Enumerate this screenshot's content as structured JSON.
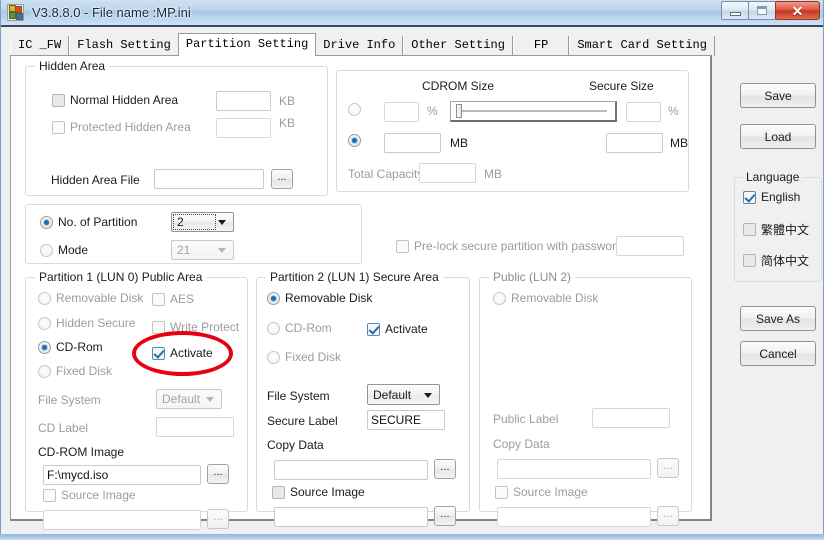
{
  "window": {
    "title": "V3.8.8.0 - File name :MP.ini",
    "icon": "blocks-icon",
    "buttons": {
      "minimize": "minimize-icon",
      "maximize": "maximize-icon",
      "close": "close-icon"
    }
  },
  "tabs": [
    {
      "label": "IC _FW",
      "selected": false
    },
    {
      "label": "Flash Setting",
      "selected": false
    },
    {
      "label": "Partition Setting",
      "selected": true
    },
    {
      "label": "Drive Info",
      "selected": false
    },
    {
      "label": "Other Setting",
      "selected": false
    },
    {
      "label": "FP",
      "selected": false
    },
    {
      "label": "Smart Card Setting",
      "selected": false
    }
  ],
  "hidden_area": {
    "legend": "Hidden Area",
    "normal": {
      "label": "Normal Hidden Area",
      "checked": false,
      "value": "",
      "unit": "KB"
    },
    "protected": {
      "label": "Protected Hidden Area",
      "checked": false,
      "disabled": true,
      "value": "",
      "unit": "KB"
    },
    "file": {
      "label": "Hidden Area File",
      "value": "",
      "browse": "..."
    }
  },
  "size_panel": {
    "cdrom_header": "CDROM Size",
    "secure_header": "Secure Size",
    "percent_row": {
      "selected": false,
      "cdrom_value": "",
      "cdrom_unit": "%",
      "secure_value": "",
      "secure_unit": "%"
    },
    "mb_row": {
      "selected": true,
      "cdrom_value": "",
      "cdrom_unit": "MB",
      "secure_value": "",
      "secure_unit": "MB"
    },
    "slider": {
      "value": 0,
      "min": 0,
      "max": 100
    },
    "total_capacity": {
      "label": "Total Capacity",
      "value": "",
      "unit": "MB",
      "disabled": true
    }
  },
  "partition_mode": {
    "no_of_partition": {
      "label": "No. of Partition",
      "selected": true,
      "value": "2"
    },
    "mode": {
      "label": "Mode",
      "selected": false,
      "value": "21",
      "disabled": true
    }
  },
  "prelock": {
    "label": "Pre-lock secure partition with password :",
    "checked": false,
    "disabled": true,
    "password": ""
  },
  "partition1": {
    "legend": "Partition 1 (LUN 0) Public Area",
    "radios": [
      {
        "label": "Removable Disk",
        "selected": false
      },
      {
        "label": "Hidden Secure",
        "selected": false
      },
      {
        "label": "CD-Rom",
        "selected": true
      },
      {
        "label": "Fixed Disk",
        "selected": false
      }
    ],
    "aes": {
      "label": "AES",
      "checked": false,
      "disabled": true
    },
    "write_protect": {
      "label": "Write Protect",
      "checked": false,
      "disabled": true
    },
    "activate": {
      "label": "Activate",
      "checked": true
    },
    "file_system": {
      "label": "File System",
      "value": "Default",
      "disabled": true
    },
    "cd_label": {
      "label": "CD Label",
      "value": "",
      "disabled": true
    },
    "cdrom_image": {
      "label": "CD-ROM Image",
      "value": "F:\\mycd.iso",
      "browse": "..."
    },
    "source_image": {
      "label": "Source Image",
      "checked": false,
      "disabled": true,
      "value": "",
      "browse": "..."
    }
  },
  "partition2": {
    "legend": "Partition 2 (LUN 1) Secure Area",
    "radios": [
      {
        "label": "Removable Disk",
        "selected": true
      },
      {
        "label": "CD-Rom",
        "selected": false
      },
      {
        "label": "Fixed Disk",
        "selected": false
      }
    ],
    "activate": {
      "label": "Activate",
      "checked": true
    },
    "file_system": {
      "label": "File System",
      "value": "Default"
    },
    "secure_label": {
      "label": "Secure Label",
      "value": "SECURE"
    },
    "copy_data": {
      "label": "Copy Data",
      "value": "",
      "browse": "..."
    },
    "source_image": {
      "label": "Source Image",
      "checked": false,
      "value": "",
      "browse": "..."
    }
  },
  "partition3": {
    "legend": "Public (LUN 2)",
    "removable": {
      "label": "Removable Disk",
      "selected": false,
      "disabled": true
    },
    "public_label": {
      "label": "Public Label",
      "value": "",
      "disabled": true
    },
    "copy_data": {
      "label": "Copy Data",
      "value": "",
      "browse": "...",
      "disabled": true
    },
    "source_image": {
      "label": "Source Image",
      "checked": false,
      "value": "",
      "browse": "..."
    }
  },
  "sidebar": {
    "save": "Save",
    "load": "Load",
    "language": {
      "legend": "Language",
      "options": [
        {
          "label": "English",
          "checked": true
        },
        {
          "label": "繁體中文",
          "checked": false
        },
        {
          "label": "简体中文",
          "checked": false
        }
      ]
    },
    "save_as": "Save As",
    "cancel": "Cancel"
  },
  "annotation": {
    "shape": "red-ellipse",
    "color": "#e60012",
    "targets": "activate-checkbox-partition1"
  }
}
